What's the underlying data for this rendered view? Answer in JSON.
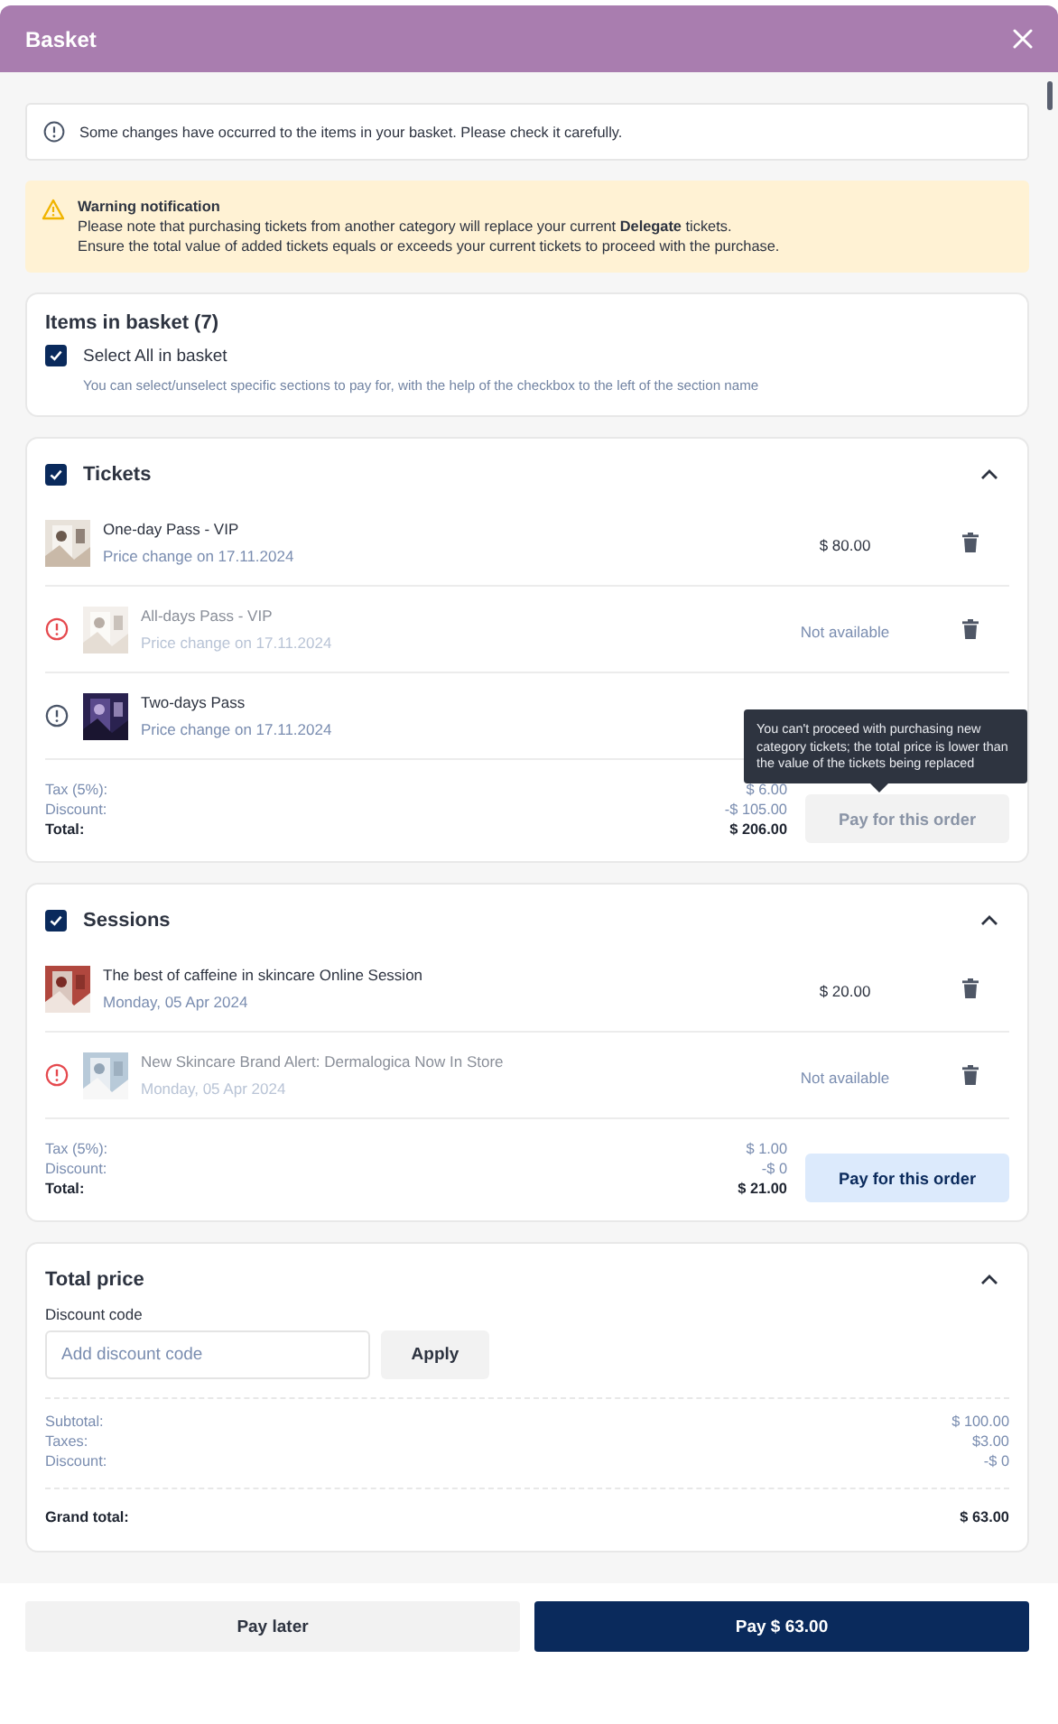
{
  "window": {
    "title": "Basket"
  },
  "notice": {
    "text": "Some changes have occurred to the items in your basket. Please check it carefully."
  },
  "warning": {
    "title": "Warning notification",
    "lines": [
      "Please note that purchasing tickets from another category will replace your current **Delegate** tickets.",
      "Ensure the total value of added tickets equals or exceeds your current tickets to proceed with the purchase."
    ]
  },
  "basket": {
    "title": "Items in basket (7)",
    "select_all": {
      "label": "Select All in basket",
      "checked": true
    },
    "hint": "You can select/unselect specific sections to pay for, with the help of the checkbox to the left of the section name"
  },
  "sections": [
    {
      "title": "Tickets",
      "checked": true,
      "expanded": true,
      "items": [
        {
          "name": "One-day Pass - VIP",
          "subtitle": "Price change on 17.11.2024",
          "price": "$ 80.00",
          "available": true,
          "kind": "plain"
        },
        {
          "name": "All-days Pass - VIP",
          "subtitle": "Price change on 17.11.2024",
          "price": "Not available",
          "available": false,
          "kind": "error"
        },
        {
          "name": "Two-days Pass",
          "subtitle": "Price change on 17.11.2024",
          "available": true,
          "kind": "info"
        }
      ],
      "summary": [
        {
          "label": "Tax (5%):",
          "value": "$ 6.00",
          "bold": false
        },
        {
          "label": "Discount:",
          "value": "-$ 105.00",
          "bold": false
        },
        {
          "label": "Total:",
          "value": "$ 206.00",
          "bold": true
        }
      ],
      "pay_button": {
        "label": "Pay for this order",
        "disabled": true
      },
      "tooltip": "You can't proceed with purchasing new category tickets; the total price is lower than the value of the tickets being replaced"
    },
    {
      "title": "Sessions",
      "checked": true,
      "expanded": true,
      "items": [
        {
          "name": "The best of caffeine in skincare Online Session",
          "subtitle": "Monday, 05 Apr 2024",
          "price": "$ 20.00",
          "available": true,
          "kind": "plain"
        },
        {
          "name": "New Skincare Brand Alert: Dermalogica Now In Store",
          "subtitle": "Monday, 05 Apr 2024",
          "price": "Not available",
          "available": false,
          "kind": "error"
        }
      ],
      "summary": [
        {
          "label": "Tax (5%):",
          "value": "$ 1.00",
          "bold": false
        },
        {
          "label": "Discount:",
          "value": "-$ 0",
          "bold": false
        },
        {
          "label": "Total:",
          "value": "$ 21.00",
          "bold": true
        }
      ],
      "pay_button": {
        "label": "Pay for this order",
        "disabled": false
      }
    }
  ],
  "total": {
    "title": "Total price",
    "expanded": true,
    "discount_label": "Discount code",
    "placeholder": "Add discount code",
    "apply": "Apply",
    "rows": [
      {
        "label": "Subtotal:",
        "value": "$ 100.00"
      },
      {
        "label": "Taxes:",
        "value": "$3.00"
      },
      {
        "label": "Discount:",
        "value": "-$ 0"
      }
    ],
    "grand_total": {
      "label": "Grand total:",
      "value": "$ 63.00"
    }
  },
  "footer": {
    "secondary": "Pay later",
    "primary": "Pay $ 63.00"
  }
}
